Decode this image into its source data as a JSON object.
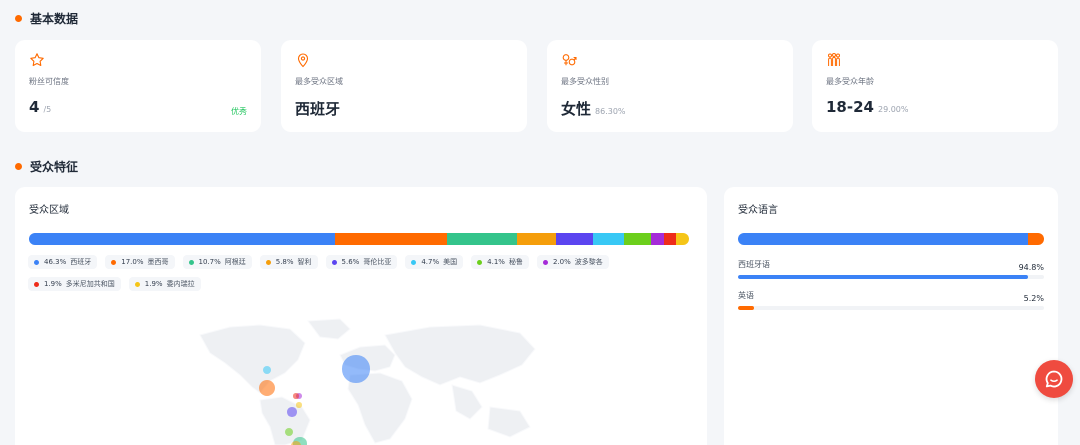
{
  "sections": {
    "basic_title": "基本数据",
    "audience_title": "受众特征"
  },
  "stats": [
    {
      "icon": "star-icon",
      "label": "粉丝可信度",
      "value": "4",
      "sub": "/5",
      "badge": "优秀"
    },
    {
      "icon": "location-pin-icon",
      "label": "最多受众区域",
      "value": "西班牙",
      "sub": "",
      "badge": ""
    },
    {
      "icon": "gender-icon",
      "label": "最多受众性别",
      "value": "女性",
      "sub": "86.30%",
      "badge": ""
    },
    {
      "icon": "people-age-icon",
      "label": "最多受众年龄",
      "value": "18-24",
      "sub": "29.00%",
      "badge": ""
    }
  ],
  "colors": {
    "accent": "#ff6a00",
    "good": "#22c55e",
    "chat": "#ef4b3f"
  },
  "region": {
    "title": "受众区域",
    "items": [
      {
        "pct": "46.3%",
        "share": 46.3,
        "name": "西班牙",
        "color": "#3b82f6"
      },
      {
        "pct": "17.0%",
        "share": 17.0,
        "name": "墨西哥",
        "color": "#ff6a00"
      },
      {
        "pct": "10.7%",
        "share": 10.7,
        "name": "阿根廷",
        "color": "#34c48b"
      },
      {
        "pct": "5.8%",
        "share": 5.8,
        "name": "智利",
        "color": "#f59e0b"
      },
      {
        "pct": "5.6%",
        "share": 5.6,
        "name": "哥伦比亚",
        "color": "#5b45f0"
      },
      {
        "pct": "4.7%",
        "share": 4.7,
        "name": "美国",
        "color": "#38c8f5"
      },
      {
        "pct": "4.1%",
        "share": 4.1,
        "name": "秘鲁",
        "color": "#6ccf1c"
      },
      {
        "pct": "2.0%",
        "share": 2.0,
        "name": "波多黎各",
        "color": "#a52bd8"
      },
      {
        "pct": "1.9%",
        "share": 1.9,
        "name": "多米尼加共和国",
        "color": "#ee2c1a"
      },
      {
        "pct": "1.9%",
        "share": 1.9,
        "name": "委内瑞拉",
        "color": "#f5c518"
      }
    ]
  },
  "language": {
    "title": "受众语言",
    "items": [
      {
        "name": "西班牙语",
        "pct": "94.8%",
        "share": 94.8,
        "color": "#3b82f6"
      },
      {
        "name": "英语",
        "pct": "5.2%",
        "share": 5.2,
        "color": "#ff6a00"
      }
    ]
  }
}
